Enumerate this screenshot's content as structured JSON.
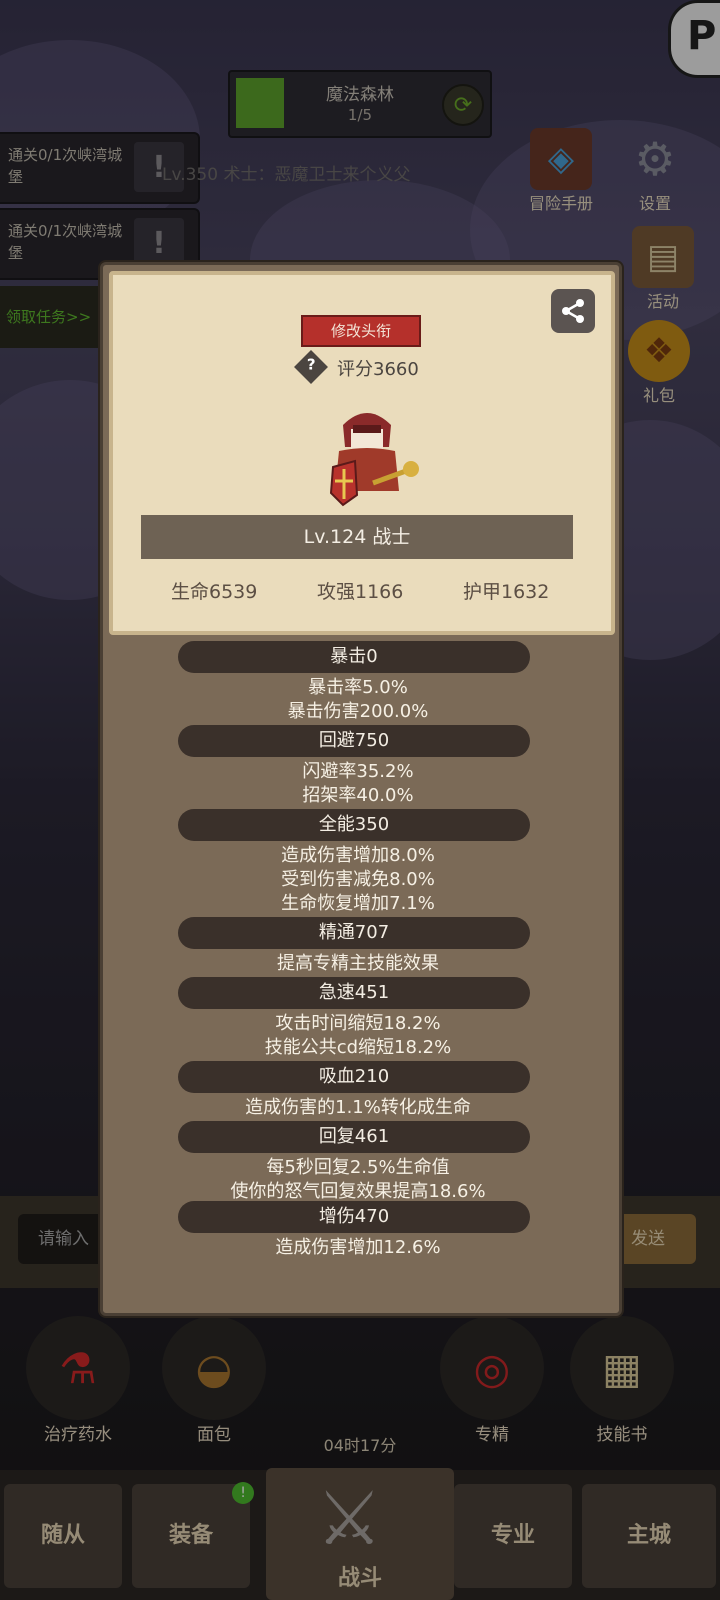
{
  "top_bar": {
    "stage_name": "魔法森林",
    "progress": "1/5"
  },
  "quests": [
    {
      "text": "通关0/1次峡湾城堡"
    },
    {
      "text": "通关0/1次峡湾城堡"
    }
  ],
  "player_line": "Lv.350 术士：恶魔卫士来个义父",
  "claim_quest": "领取任务>>",
  "side_menu": [
    {
      "label": "冒险手册",
      "icon": "book-icon"
    },
    {
      "label": "设置",
      "icon": "gear-icon"
    },
    {
      "label": "活动",
      "icon": "scroll-icon"
    },
    {
      "label": "礼包",
      "icon": "gift-icon"
    }
  ],
  "chat": {
    "placeholder": "请输入",
    "send": "发送"
  },
  "items": [
    {
      "label": "治疗药水",
      "icon": "potion-icon"
    },
    {
      "label": "面包",
      "icon": "bread-icon"
    },
    {
      "label": "专精",
      "icon": "target-icon"
    },
    {
      "label": "技能书",
      "icon": "skill-book-icon"
    }
  ],
  "timer": "04时17分",
  "tabs": {
    "followers": "随从",
    "equipment": "装备",
    "battle": "战斗",
    "profession": "专业",
    "city": "主城"
  },
  "equip_badge": "!",
  "profile": {
    "edit_title": "修改头衔",
    "score": "评分3660",
    "level_class": "Lv.124 战士",
    "hp": "生命6539",
    "attack": "攻强1166",
    "armor": "护甲1632"
  },
  "stats": [
    {
      "head": "暴击0",
      "lines": [
        "暴击率5.0%",
        "暴击伤害200.0%"
      ]
    },
    {
      "head": "回避750",
      "lines": [
        "闪避率35.2%",
        "招架率40.0%"
      ]
    },
    {
      "head": "全能350",
      "lines": [
        "造成伤害增加8.0%",
        "受到伤害减免8.0%",
        "生命恢复增加7.1%"
      ]
    },
    {
      "head": "精通707",
      "lines": [
        "提高专精主技能效果"
      ]
    },
    {
      "head": "急速451",
      "lines": [
        "攻击时间缩短18.2%",
        "技能公共cd缩短18.2%"
      ]
    },
    {
      "head": "吸血210",
      "lines": [
        "造成伤害的1.1%转化成生命"
      ]
    },
    {
      "head": "回复461",
      "lines": [
        "每5秒回复2.5%生命值",
        "使你的怒气回复效果提高18.6%"
      ]
    },
    {
      "head": "增伤470",
      "lines": [
        "造成伤害增加12.6%"
      ]
    }
  ]
}
